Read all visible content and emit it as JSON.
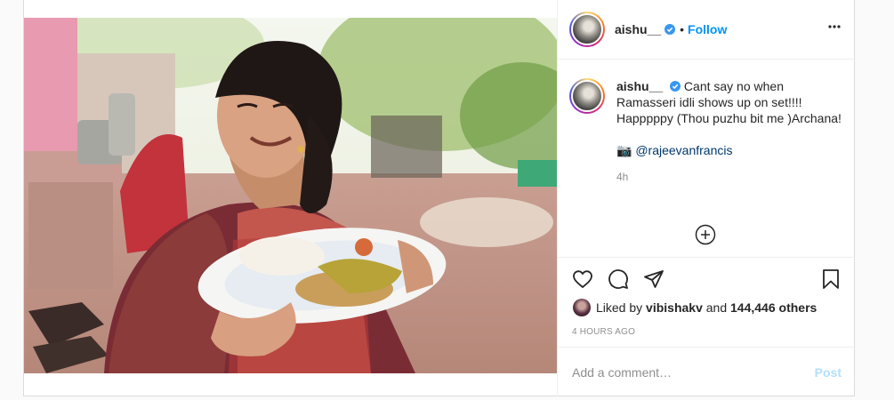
{
  "post": {
    "username": "aishu__",
    "follow_label": "Follow",
    "dot": "•",
    "caption_text": "Cant say no when Ramasseri idli shows up on set!!!! Happpppy (Thou puzhu bit me )Archana!",
    "credit_emoji": "📷",
    "mention": "@rajeevanfrancis",
    "caption_time": "4h",
    "liked_by_prefix": "Liked by",
    "liked_by_user": "vibishakv",
    "and_label": "and",
    "others": "144,446 others",
    "posted_ago": "4 HOURS AGO",
    "comment_placeholder": "Add a comment…",
    "post_label": "Post"
  },
  "icons": [
    "verified-badge-icon",
    "more-options-icon",
    "load-more-icon",
    "heart-icon",
    "comment-icon",
    "share-icon",
    "bookmark-icon"
  ],
  "colors": {
    "accent": "#0095f6",
    "post_disabled": "#b2dffc",
    "muted": "#8e8e8e",
    "mention": "#00376b"
  }
}
